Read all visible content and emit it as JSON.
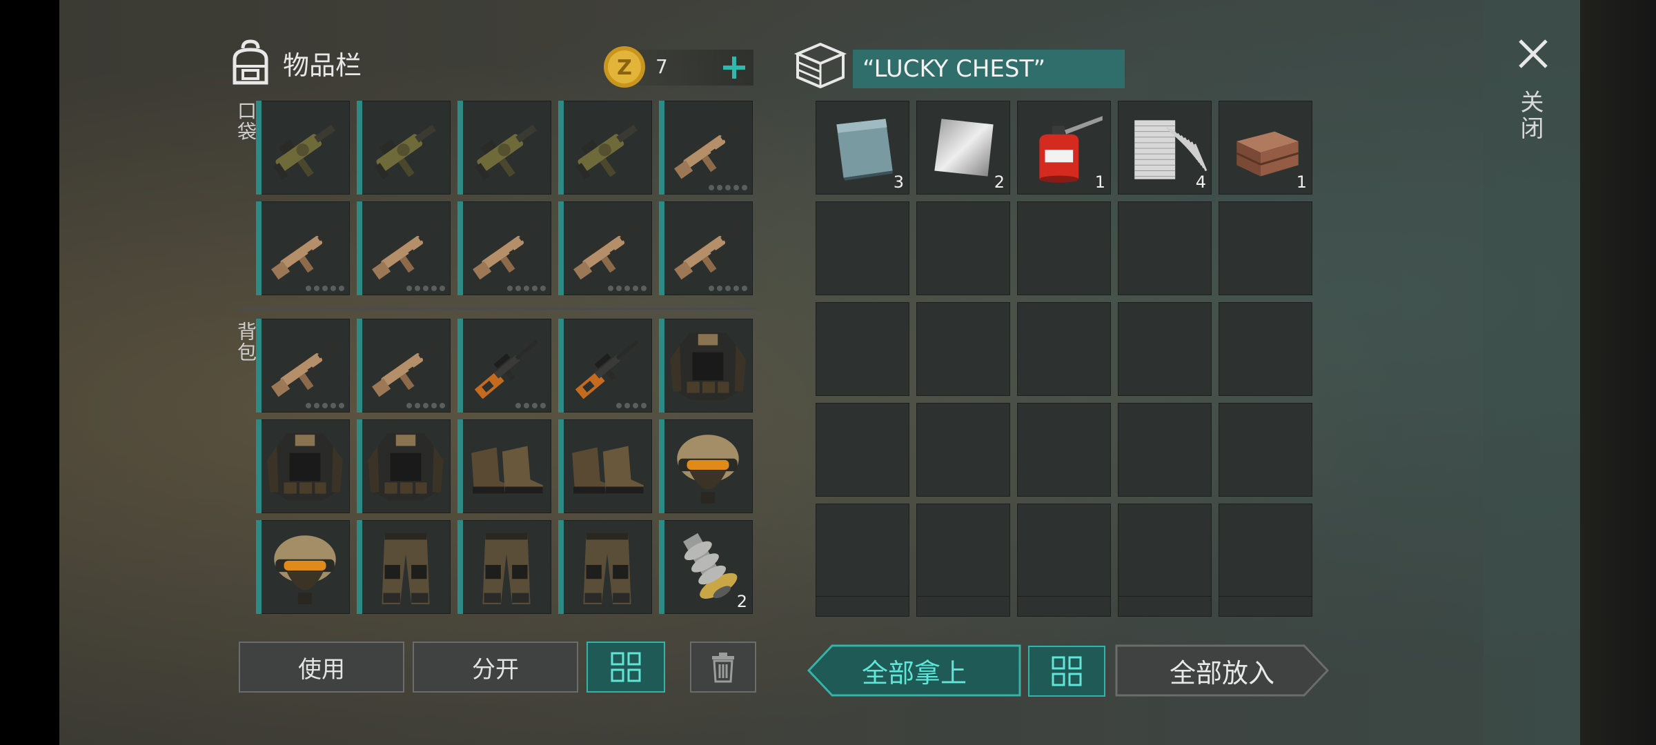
{
  "inventory": {
    "title": "物品栏",
    "coins": "7",
    "pocket_label": "口袋",
    "backpack_label": "背包",
    "pocket_slots": [
      {
        "item": "grenade-launcher"
      },
      {
        "item": "grenade-launcher"
      },
      {
        "item": "grenade-launcher"
      },
      {
        "item": "grenade-launcher"
      },
      {
        "item": "assault-rifle",
        "dots": 5
      },
      {
        "item": "assault-rifle",
        "dots": 5
      },
      {
        "item": "assault-rifle",
        "dots": 5
      },
      {
        "item": "assault-rifle",
        "dots": 5
      },
      {
        "item": "assault-rifle",
        "dots": 5
      },
      {
        "item": "assault-rifle",
        "dots": 5
      }
    ],
    "backpack_slots": [
      {
        "item": "assault-rifle",
        "dots": 5
      },
      {
        "item": "assault-rifle",
        "dots": 5
      },
      {
        "item": "sniper-rifle",
        "dots": 4
      },
      {
        "item": "sniper-rifle",
        "dots": 4
      },
      {
        "item": "tactical-vest"
      },
      {
        "item": "tactical-vest"
      },
      {
        "item": "tactical-vest"
      },
      {
        "item": "boots"
      },
      {
        "item": "boots"
      },
      {
        "item": "helmet"
      },
      {
        "item": "helmet"
      },
      {
        "item": "pants"
      },
      {
        "item": "pants"
      },
      {
        "item": "pants"
      },
      {
        "item": "gear-part",
        "qty": "2"
      }
    ],
    "buttons": {
      "use": "使用",
      "split": "分开"
    }
  },
  "chest": {
    "title": "“LUCKY CHEST”",
    "slots": [
      {
        "item": "steel-sheet",
        "qty": "3"
      },
      {
        "item": "aluminum-sheet",
        "qty": "2"
      },
      {
        "item": "oil-can",
        "qty": "1"
      },
      {
        "item": "nails",
        "qty": "4"
      },
      {
        "item": "bricks",
        "qty": "1"
      }
    ],
    "buttons": {
      "take_all": "全部拿上",
      "put_all": "全部放入"
    }
  },
  "close_label": "关闭",
  "colors": {
    "accent": "#2f6e6a",
    "accent_bright": "#5fe6d8",
    "slot_bg": "#2b2f2e"
  }
}
